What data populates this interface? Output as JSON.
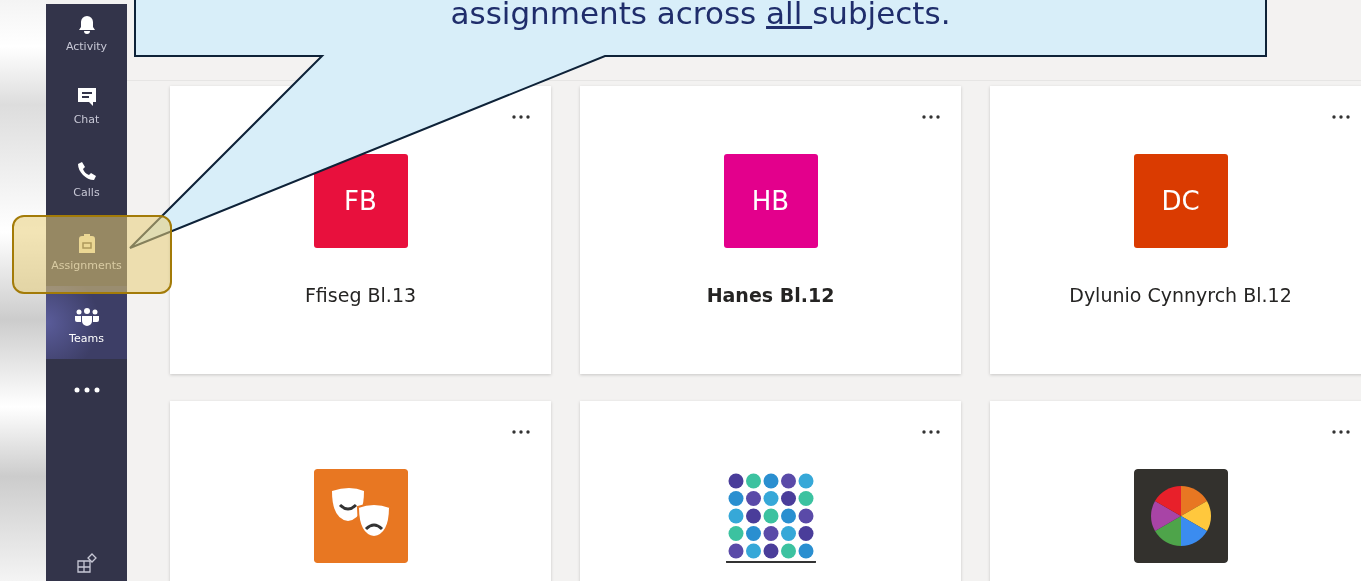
{
  "callout": {
    "text": [
      {
        "text": "assignments across ",
        "underline": false
      },
      {
        "text": "all ",
        "underline": true
      },
      {
        "text": "subjects.",
        "underline": false
      }
    ]
  },
  "app_bar": {
    "items": [
      {
        "label": "Activity",
        "kind": "bell",
        "selected": false,
        "highlighted": false
      },
      {
        "label": "Chat",
        "kind": "chat",
        "selected": false,
        "highlighted": false
      },
      {
        "label": "Calls",
        "kind": "phone",
        "selected": false,
        "highlighted": false
      },
      {
        "label": "Assignments",
        "kind": "backpack",
        "selected": false,
        "highlighted": true
      },
      {
        "label": "Teams",
        "kind": "people",
        "selected": true,
        "highlighted": false
      }
    ]
  },
  "teams": [
    {
      "kind": "initials",
      "initials": "FB",
      "name": "Ffiseg Bl.13",
      "color": "#e8103d",
      "unread": false
    },
    {
      "kind": "initials",
      "initials": "HB",
      "name": "Hanes Bl.12",
      "color": "#e3008c",
      "unread": true
    },
    {
      "kind": "initials",
      "initials": "DC",
      "name": "Dylunio Cynnyrch Bl.12",
      "color": "#da3b01",
      "unread": false
    },
    {
      "kind": "masks"
    },
    {
      "kind": "icons"
    },
    {
      "kind": "wheel"
    }
  ]
}
